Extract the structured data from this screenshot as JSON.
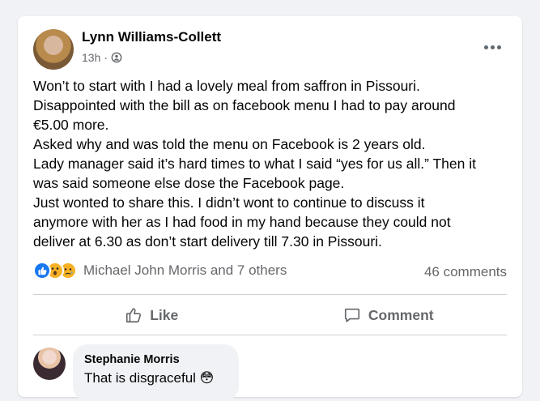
{
  "post": {
    "author": "Lynn Williams-Collett",
    "time": "13h",
    "separator": "·",
    "privacy_icon": "friends-icon",
    "text_lines": [
      "Won’t to start with I had a lovely meal from saffron in Pissouri.",
      "Disappointed with the bill as on facebook menu I had to pay around",
      "€5.00 more.",
      "Asked why and was told the menu on Facebook is 2 years old.",
      "Lady manager said it’s hard times to what I said “yes for us all.” Then it",
      "was said someone else dose the Facebook page.",
      "Just wonted to share this. I didn’t wont to continue to discuss it",
      "anymore with her as I had food in my hand because they could not",
      "deliver at 6.30 as don’t start delivery till 7.30 in Pissouri."
    ]
  },
  "reactions": {
    "icons": [
      "like-reaction-icon",
      "wow-reaction-icon",
      "sad-reaction-icon"
    ],
    "names": "Michael John Morris and 7 others",
    "comments_count": "46 comments"
  },
  "actions": {
    "like_label": "Like",
    "comment_label": "Comment"
  },
  "comment": {
    "author": "Stephanie Morris",
    "text": "That is disgraceful 😳"
  },
  "colors": {
    "background": "#f0f2f5",
    "card": "#ffffff",
    "secondary_text": "#65676b",
    "like_blue": "#1877f2"
  }
}
